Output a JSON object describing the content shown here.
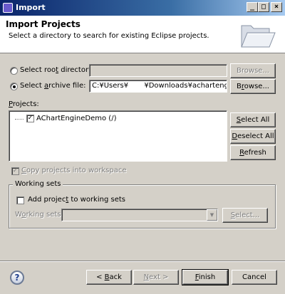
{
  "window": {
    "title": "Import",
    "controls": {
      "minimize": "_",
      "maximize": "□",
      "close": "×"
    }
  },
  "header": {
    "title": "Import Projects",
    "description": "Select a directory to search for existing Eclipse projects.",
    "icon": "folder-open-icon"
  },
  "source": {
    "root_directory": {
      "label_pre": "Select roo",
      "label_mnemonic": "t",
      "label_post": " directory:",
      "value": "",
      "selected": false,
      "browse_label": "Browse..."
    },
    "archive_file": {
      "label_pre": "Select ",
      "label_mnemonic": "a",
      "label_post": "rchive file:",
      "value": "C:¥Users¥       ¥Downloads¥achartengine-",
      "selected": true,
      "browse_label_pre": "B",
      "browse_label_mnemonic": "r",
      "browse_label_post": "owse..."
    }
  },
  "projects": {
    "label_mnemonic": "P",
    "label_post": "rojects:",
    "items": [
      {
        "name": "AChartEngineDemo (/)",
        "checked": true
      }
    ],
    "select_all": {
      "pre": "",
      "mn": "S",
      "post": "elect All"
    },
    "deselect_all": {
      "pre": "",
      "mn": "D",
      "post": "eselect All"
    },
    "refresh": {
      "pre": "",
      "mn": "R",
      "post": "efresh"
    }
  },
  "copy_into_workspace": {
    "label_pre": "",
    "label_mnemonic": "C",
    "label_post": "opy projects into workspace",
    "checked": true,
    "enabled": false
  },
  "working_sets": {
    "group_label": "Working sets",
    "add_label_pre": "Add projec",
    "add_label_mnemonic": "t",
    "add_label_post": " to working sets",
    "add_checked": false,
    "sets_label_pre": "W",
    "sets_label_mnemonic": "o",
    "sets_label_post": "rking sets:",
    "select_label_pre": "",
    "select_label_mnemonic": "S",
    "select_label_post": "elect..."
  },
  "footer": {
    "help": "?",
    "back": {
      "pre": "< ",
      "mn": "B",
      "post": "ack"
    },
    "next": {
      "pre": "",
      "mn": "N",
      "post": "ext >"
    },
    "finish": {
      "pre": "",
      "mn": "F",
      "post": "inish"
    },
    "cancel": "Cancel"
  }
}
